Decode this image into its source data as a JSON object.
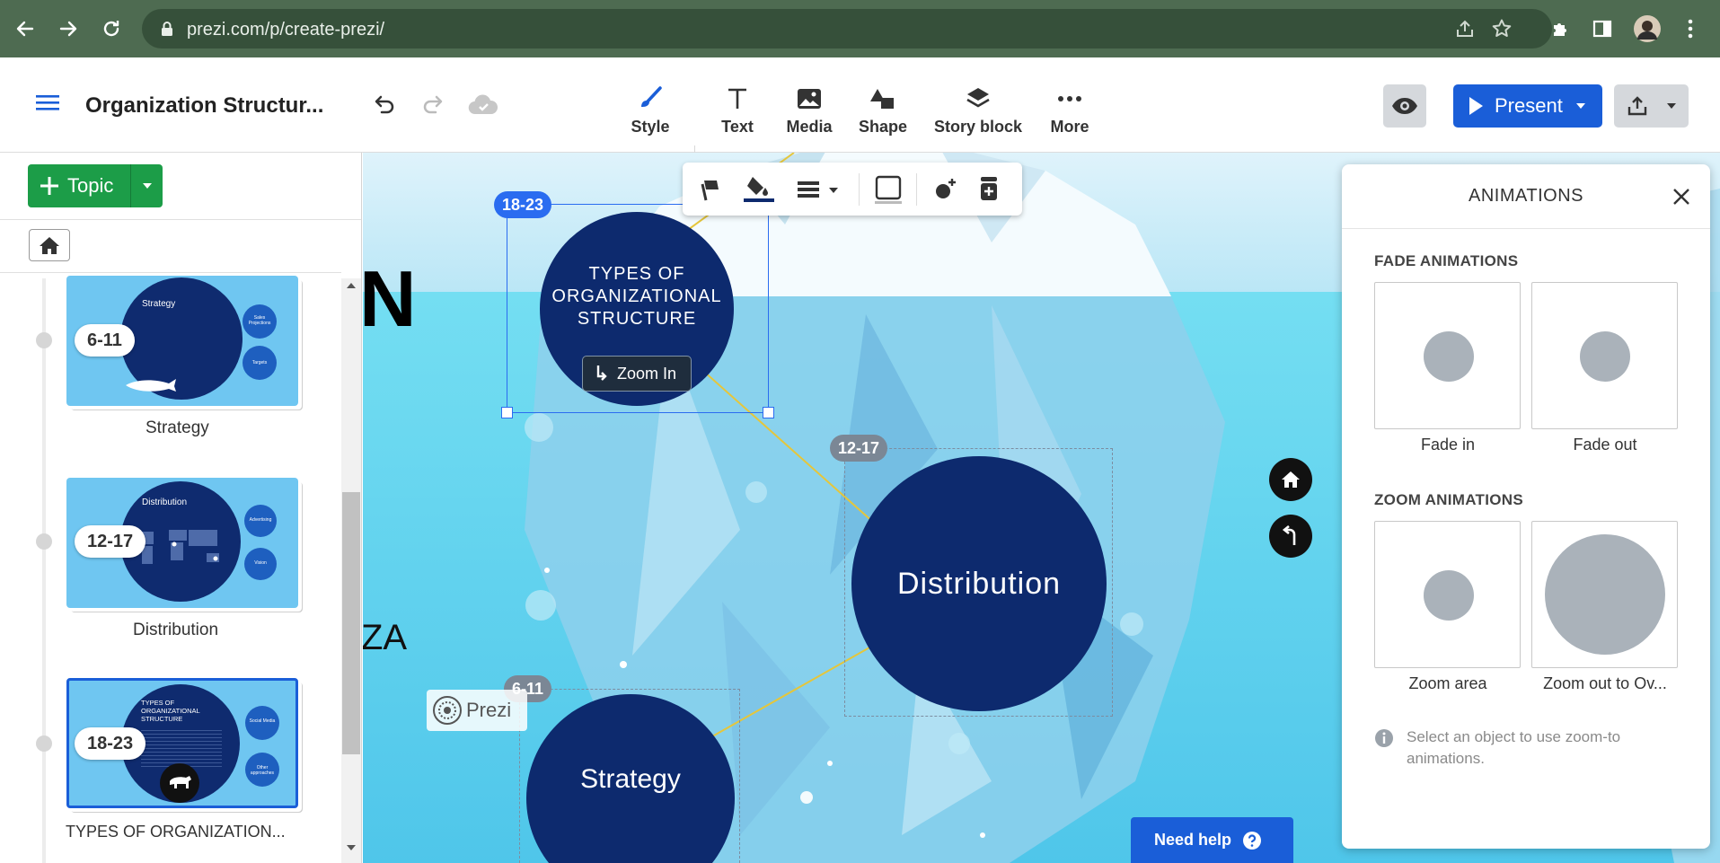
{
  "browser": {
    "url": "prezi.com/p/create-prezi/"
  },
  "header": {
    "doc_title": "Organization Structur...",
    "tools": [
      {
        "label": "Style",
        "icon": "brush-icon"
      },
      {
        "label": "Text",
        "icon": "text-icon"
      },
      {
        "label": "Media",
        "icon": "image-icon"
      },
      {
        "label": "Shape",
        "icon": "shape-icon"
      },
      {
        "label": "Story block",
        "icon": "layers-icon"
      },
      {
        "label": "More",
        "icon": "more-icon"
      }
    ],
    "present_label": "Present"
  },
  "sidebar": {
    "topic_label": "Topic",
    "slides": [
      {
        "badge": "6-11",
        "caption": "Strategy",
        "thumb_title": "Strategy",
        "side_labels": [
          "Sales Projections",
          "Targets"
        ]
      },
      {
        "badge": "12-17",
        "caption": "Distribution",
        "thumb_title": "Distribution",
        "side_labels": [
          "Advertising",
          "Vision"
        ]
      },
      {
        "badge": "18-23",
        "caption": "TYPES OF ORGANIZATION...",
        "thumb_title": "TYPES OF ORGANIZATIONAL STRUCTURE",
        "side_labels": [
          "Social Media",
          "Other approaches"
        ],
        "selected": true
      }
    ]
  },
  "canvas": {
    "partial_title_1": "N",
    "partial_title_2": "ZA",
    "selected_topic": {
      "badge": "18-23",
      "text": "TYPES OF ORGANIZATIONAL STRUCTURE",
      "zoom_label": "Zoom In"
    },
    "distribution": {
      "badge": "12-17",
      "text": "Distribution"
    },
    "strategy": {
      "badge": "6-11",
      "text": "Strategy"
    },
    "prezi_logo": "Prezi",
    "need_help": "Need help"
  },
  "animations": {
    "title": "ANIMATIONS",
    "fade_title": "FADE ANIMATIONS",
    "fade": [
      "Fade in",
      "Fade out"
    ],
    "zoom_title": "ZOOM ANIMATIONS",
    "zoom": [
      "Zoom area",
      "Zoom out to Ov..."
    ],
    "hint": "Select an object to use zoom-to animations."
  },
  "colors": {
    "chrome": "#4e6b51",
    "brand_blue": "#1a5ed8",
    "topic_green": "#1c9d48",
    "circle_navy": "#0d2a6e",
    "water": "#6ddaf0"
  }
}
